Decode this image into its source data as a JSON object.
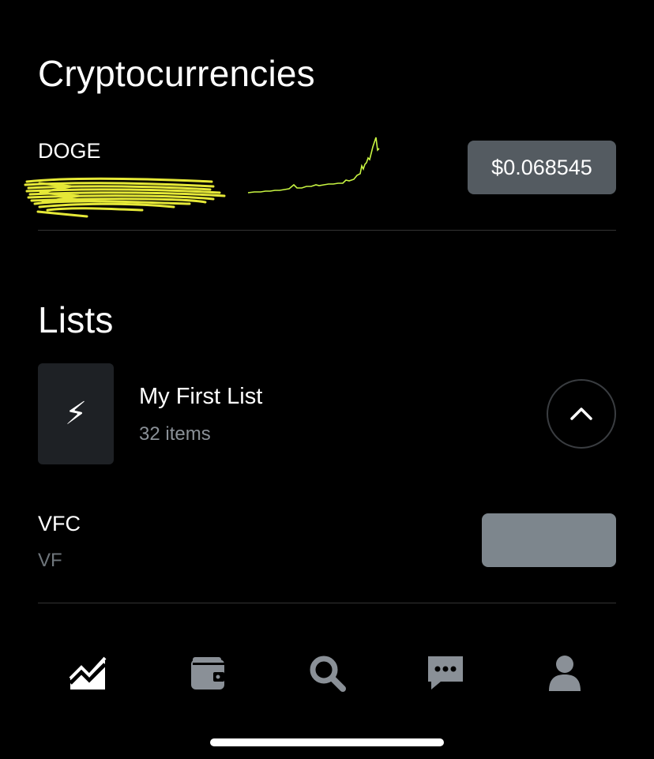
{
  "crypto_section": {
    "title": "Cryptocurrencies",
    "items": [
      {
        "ticker": "DOGE",
        "price": "$0.068545",
        "trend_color": "#c8f542"
      }
    ]
  },
  "lists_section": {
    "title": "Lists",
    "list": {
      "icon": "⚡",
      "name": "My First List",
      "count": "32 items",
      "toggle_icon": "chevron-up-icon"
    },
    "stocks": [
      {
        "ticker": "VFC",
        "name": "VF",
        "price": ""
      }
    ]
  },
  "tabbar": {
    "items": [
      {
        "name": "investing",
        "icon": "chart-icon",
        "active": true
      },
      {
        "name": "wallet",
        "icon": "wallet-icon",
        "active": false
      },
      {
        "name": "search",
        "icon": "search-icon",
        "active": false
      },
      {
        "name": "messages",
        "icon": "chat-icon",
        "active": false
      },
      {
        "name": "account",
        "icon": "person-icon",
        "active": false
      }
    ]
  },
  "colors": {
    "background": "#000000",
    "accent_green": "#c8f542",
    "price_pill": "#545b61",
    "stock_pill": "#7d868d",
    "icon_inactive": "#8a9097"
  }
}
